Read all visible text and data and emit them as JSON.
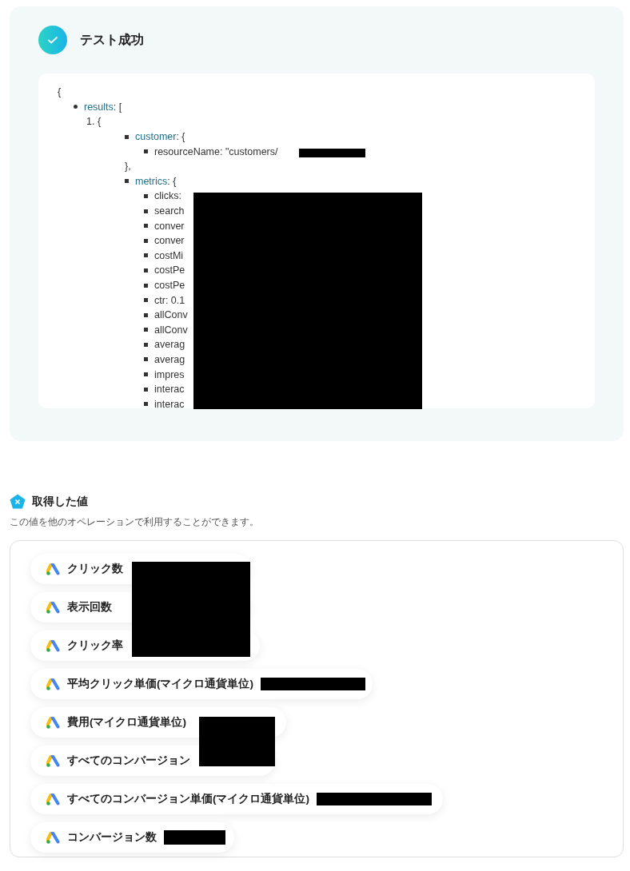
{
  "test_result": {
    "title": "テスト成功",
    "code": {
      "open": "{",
      "entries": [
        {
          "key": "results",
          "suffix": ": [",
          "items": [
            {
              "marker": "1.",
              "open": "{",
              "entries": [
                {
                  "key": "customer",
                  "suffix": ": {",
                  "entries": [
                    {
                      "text": "resourceName: \"customers/"
                    }
                  ],
                  "close": "},"
                },
                {
                  "key": "metrics",
                  "suffix": ": {",
                  "entries": [
                    {
                      "text": "clicks:"
                    },
                    {
                      "text": "search"
                    },
                    {
                      "text": "conver"
                    },
                    {
                      "text": "conver"
                    },
                    {
                      "text": "costMi"
                    },
                    {
                      "text": "costPe"
                    },
                    {
                      "text": "costPe"
                    },
                    {
                      "text": "ctr: 0.1"
                    },
                    {
                      "text": "allConv"
                    },
                    {
                      "text": "allConv"
                    },
                    {
                      "text": "averag"
                    },
                    {
                      "text": "averag"
                    },
                    {
                      "text": "impres"
                    },
                    {
                      "text": "interac"
                    },
                    {
                      "text": "interac"
                    }
                  ]
                }
              ]
            }
          ]
        }
      ]
    }
  },
  "values_section": {
    "title": "取得した値",
    "description": "この値を他のオペレーションで利用することができます。",
    "items": [
      {
        "label": "クリック数"
      },
      {
        "label": "表示回数"
      },
      {
        "label": "クリック率"
      },
      {
        "label": "平均クリック単価(マイクロ通貨単位)"
      },
      {
        "label": "費用(マイクロ通貨単位)"
      },
      {
        "label": "すべてのコンバージョン"
      },
      {
        "label": "すべてのコンバージョン単価(マイクロ通貨単位)"
      },
      {
        "label": "コンバージョン数"
      }
    ]
  }
}
